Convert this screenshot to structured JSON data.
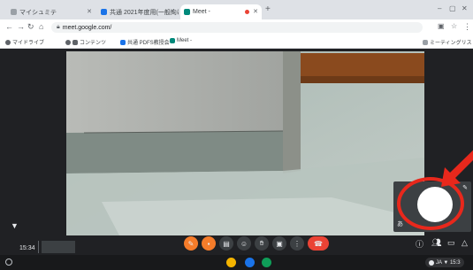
{
  "browser": {
    "tabs": [
      {
        "label": "マイシュミテ",
        "active": false
      },
      {
        "label": "共通 2021年度用(一般向け)",
        "active": false
      },
      {
        "label": "Meet - ",
        "active": true
      }
    ],
    "new_tab": "+",
    "url": "meet.google.com/",
    "bookmarks": [
      "マイドライブ",
      "コンテンツ",
      "共通 PDFS教授会",
      "Meet -",
      "ミーティングリスト"
    ]
  },
  "meet": {
    "clock": "15:34",
    "self_view_name": "あ",
    "colors": {
      "accent": "#e8281c",
      "end_call": "#ea4335",
      "muted": "#f57c2a"
    }
  },
  "shelf": {
    "tray_text": "JA ▼ 15:3"
  }
}
